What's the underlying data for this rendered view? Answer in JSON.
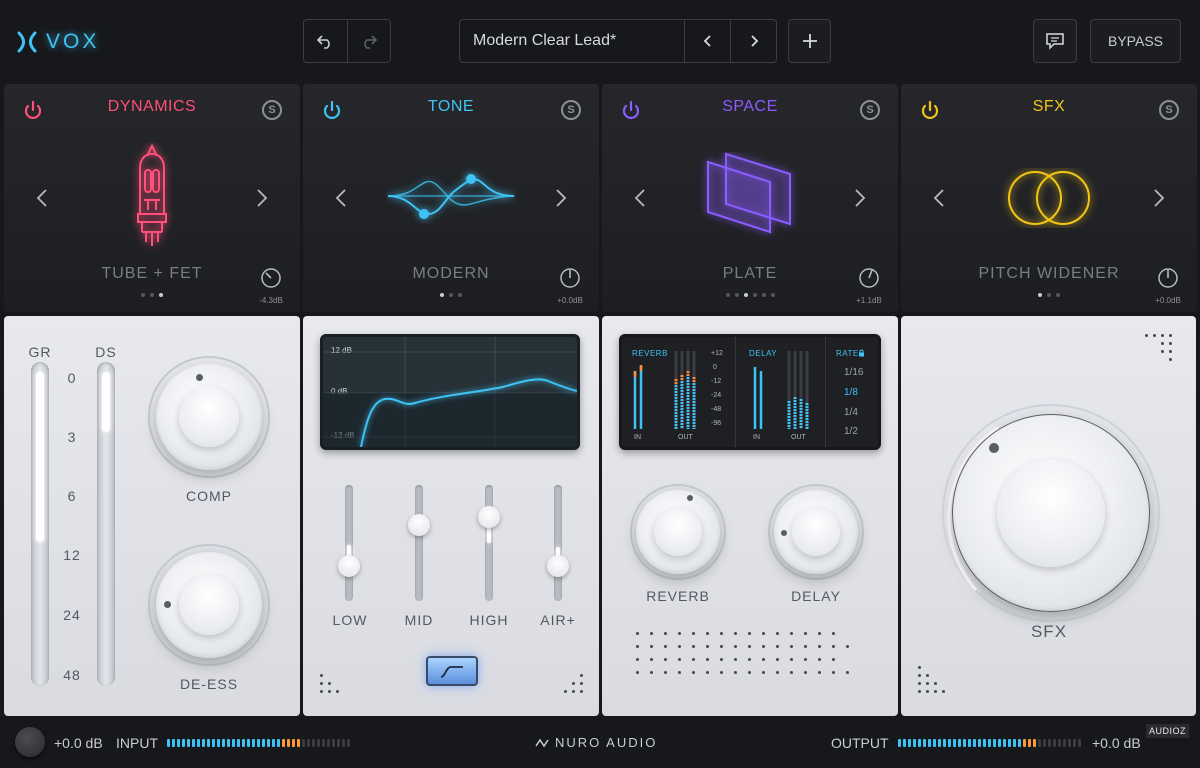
{
  "app": {
    "logo_text": "VOX",
    "accent": "#3fc3f4"
  },
  "toolbar": {
    "undo_icon": "undo-icon",
    "redo_icon": "redo-icon",
    "preset_name": "Modern Clear Lead*",
    "add_icon": "plus-icon",
    "feedback_icon": "chat-icon",
    "bypass_label": "BYPASS"
  },
  "modules": [
    {
      "title": "DYNAMICS",
      "color": "#ff4f7a",
      "mode": "TUBE + FET",
      "gain": "-4.3dB",
      "page": 3,
      "pages": 3
    },
    {
      "title": "TONE",
      "color": "#3fc3f4",
      "mode": "MODERN",
      "gain": "+0.0dB",
      "page": 1,
      "pages": 3
    },
    {
      "title": "SPACE",
      "color": "#8b5cff",
      "mode": "PLATE",
      "gain": "+1.1dB",
      "page": 3,
      "pages": 6
    },
    {
      "title": "SFX",
      "color": "#f2c515",
      "mode": "PITCH WIDENER",
      "gain": "+0.0dB",
      "page": 1,
      "pages": 3
    }
  ],
  "dynamics": {
    "meter_gr_label": "GR",
    "meter_ds_label": "DS",
    "scale": [
      "0",
      "3",
      "6",
      "12",
      "24",
      "48"
    ],
    "comp_label": "COMP",
    "deess_label": "DE-ESS"
  },
  "tone": {
    "db_labels": [
      "12 dB",
      "0 dB",
      "-12 dB"
    ],
    "bands": [
      {
        "label": "LOW",
        "level": 0.3
      },
      {
        "label": "MID",
        "level": 0.65
      },
      {
        "label": "HIGH",
        "level": 0.75
      },
      {
        "label": "AIR+",
        "level": 0.3
      }
    ]
  },
  "space": {
    "reverb_label": "REVERB",
    "delay_label": "DELAY",
    "rate_label": "RATE",
    "in_label": "IN",
    "out_label": "OUT",
    "db_scale": [
      "+12",
      "0",
      "-12",
      "-24",
      "-48",
      "-96"
    ],
    "rates": [
      "1/16",
      "1/8",
      "1/4",
      "1/2"
    ],
    "selected_rate": "1/8",
    "reverb_knob_label": "REVERB",
    "delay_knob_label": "DELAY"
  },
  "sfx": {
    "knob_label": "SFX"
  },
  "footer": {
    "input_value": "+0.0 dB",
    "input_label": "INPUT",
    "brand": "NURO AUDIO",
    "output_label": "OUTPUT",
    "output_value": "+0.0 dB",
    "watermark": "AUDIOZ"
  }
}
